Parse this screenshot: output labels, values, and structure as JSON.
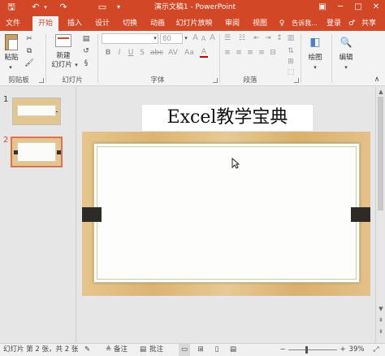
{
  "titlebar": {
    "title": "演示文稿1 - PowerPoint",
    "save_icon": "save-icon",
    "undo_icon": "undo-icon",
    "redo_icon": "redo-icon",
    "present_icon": "present-icon",
    "customize_icon": "dropdown-icon",
    "ribbon_display_icon": "ribbon-options-icon",
    "minimize_glyph": "─",
    "maximize_glyph": "□",
    "close_glyph": "✕",
    "save_glyph": "🖫",
    "undo_glyph": "↶",
    "undo_caret": "▾",
    "redo_glyph": "↷",
    "present_glyph": "▭",
    "customize_glyph": "▾",
    "ribbon_glyph": "▣"
  },
  "tabs": [
    {
      "label": "文件",
      "active": false
    },
    {
      "label": "开始",
      "active": true
    },
    {
      "label": "插入",
      "active": false
    },
    {
      "label": "设计",
      "active": false
    },
    {
      "label": "切换",
      "active": false
    },
    {
      "label": "动画",
      "active": false
    },
    {
      "label": "幻灯片放映",
      "active": false
    },
    {
      "label": "审阅",
      "active": false
    },
    {
      "label": "视图",
      "active": false
    }
  ],
  "tell_me": {
    "label": "告诉我...",
    "icon": "lightbulb-icon",
    "glyph": "♀"
  },
  "account": {
    "login": "登录",
    "share": "共享",
    "share_icon": "person-icon",
    "share_glyph": "♂"
  },
  "ribbon": {
    "clipboard": {
      "paste_label": "粘贴",
      "group_label": "剪贴板",
      "cut_glyph": "✂",
      "copy_glyph": "⧉",
      "painter_glyph": "🖌",
      "caret": "▾"
    },
    "slides": {
      "new_slide_label_line1": "新建",
      "new_slide_label_line2": "幻灯片",
      "caret": "▾",
      "group_label": "幻灯片",
      "layout_glyph": "▤",
      "reset_glyph": "↺",
      "section_glyph": "§"
    },
    "font": {
      "group_label": "字体",
      "font_size_value": "80",
      "caret": "▾",
      "grow_glyph": "A",
      "shrink_glyph": "A",
      "clear_glyph": "A",
      "bold": "B",
      "italic": "I",
      "underline": "U",
      "shadow": "S",
      "strike": "abc",
      "spacing": "AV",
      "case": "Aa",
      "color_glyph": "A"
    },
    "paragraph": {
      "group_label": "段落",
      "bullets_glyph": "☰",
      "numbering_glyph": "☷",
      "decrease_indent_glyph": "⇤",
      "increase_indent_glyph": "⇥",
      "line_spacing_glyph": "↕",
      "columns_glyph": "▥",
      "align_left_glyph": "≡",
      "center_glyph": "≡",
      "align_right_glyph": "≡",
      "justify_glyph": "≡",
      "distributed_glyph": "⊟",
      "text_direction_glyph": "⇅",
      "align_text_glyph": "⊞",
      "smartart_glyph": "⬚"
    },
    "drawing": {
      "label": "绘图",
      "caret": "▾",
      "glyph": "◧"
    },
    "editing": {
      "label": "编辑",
      "caret": "▾",
      "glyph": "🔍"
    },
    "collapse_glyph": "∧"
  },
  "thumbnails": [
    {
      "number": "1",
      "selected": false
    },
    {
      "number": "2",
      "selected": true
    }
  ],
  "slide": {
    "title_text": "Excel教学宝典"
  },
  "statusbar": {
    "slide_info": "幻灯片 第 2 张，共 2 张",
    "notes_label": "备注",
    "notes_glyph": "≜",
    "comments_label": "批注",
    "comments_glyph": "▤",
    "zoom_value": "39%",
    "zoom_out": "−",
    "zoom_in": "+",
    "spell_glyph": "✎",
    "normal_glyph": "▭",
    "sorter_glyph": "⊞",
    "reading_glyph": "▯",
    "slideshow_glyph": "▤",
    "fit_glyph": "⤢"
  },
  "scrollbar": {
    "up_glyph": "▲",
    "down_glyph": "▼",
    "prev_glyph": "⇞",
    "next_glyph": "⇟"
  },
  "colors": {
    "accent": "#d24726",
    "ribbon_bg": "#f3f3f3",
    "slide_wood": "#deb877",
    "selected_thumb_border": "#e0714f"
  }
}
